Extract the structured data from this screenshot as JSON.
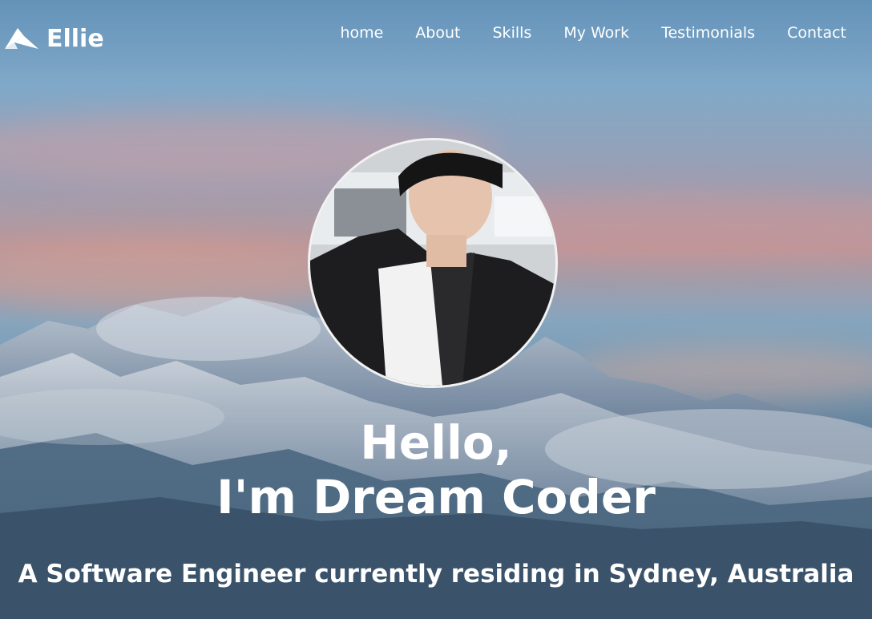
{
  "brand": {
    "name": "Ellie",
    "icon": "paper-plane-icon"
  },
  "nav": {
    "items": [
      {
        "label": "home"
      },
      {
        "label": "About"
      },
      {
        "label": "Skills"
      },
      {
        "label": "My Work"
      },
      {
        "label": "Testimonials"
      },
      {
        "label": "Contact"
      }
    ]
  },
  "hero": {
    "greeting_line1": "Hello,",
    "greeting_line2": "I'm Dream Coder",
    "tagline": "A Software Engineer currently residing in Sydney, Australia"
  },
  "colors": {
    "text": "#ffffff",
    "avatar_border": "#f2f2f2"
  }
}
